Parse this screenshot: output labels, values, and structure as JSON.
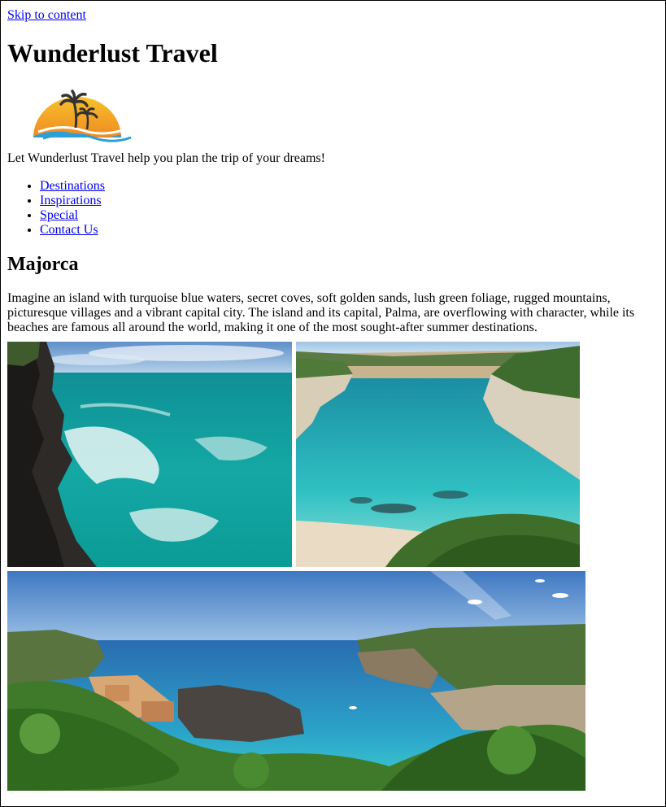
{
  "skip_link": "Skip to content",
  "site_title": "Wunderlust Travel",
  "logo": {
    "icon": "palm-sunset-logo-icon",
    "colors": {
      "sun_top": "#f6c12b",
      "sun_bottom": "#f08a22",
      "wave": "#2a9fd8",
      "palm": "#333333"
    }
  },
  "tagline": "Let Wunderlust Travel help you plan the trip of your dreams!",
  "nav": [
    "Destinations",
    "Inspirations",
    "Special",
    "Contact Us"
  ],
  "destination": {
    "heading": "Majorca",
    "description": "Imagine an island with turquoise blue waters, secret coves, soft golden sands, lush green foliage, rugged mountains, picturesque villages and a vibrant capital city. The island and its capital, Palma, are overflowing with character, while its beaches are famous all around the world, making it one of the most sought-after summer destinations."
  },
  "photos": [
    "turquoise-sea-cliffs-photo",
    "secluded-cove-beach-photo",
    "cala-panorama-photo"
  ]
}
